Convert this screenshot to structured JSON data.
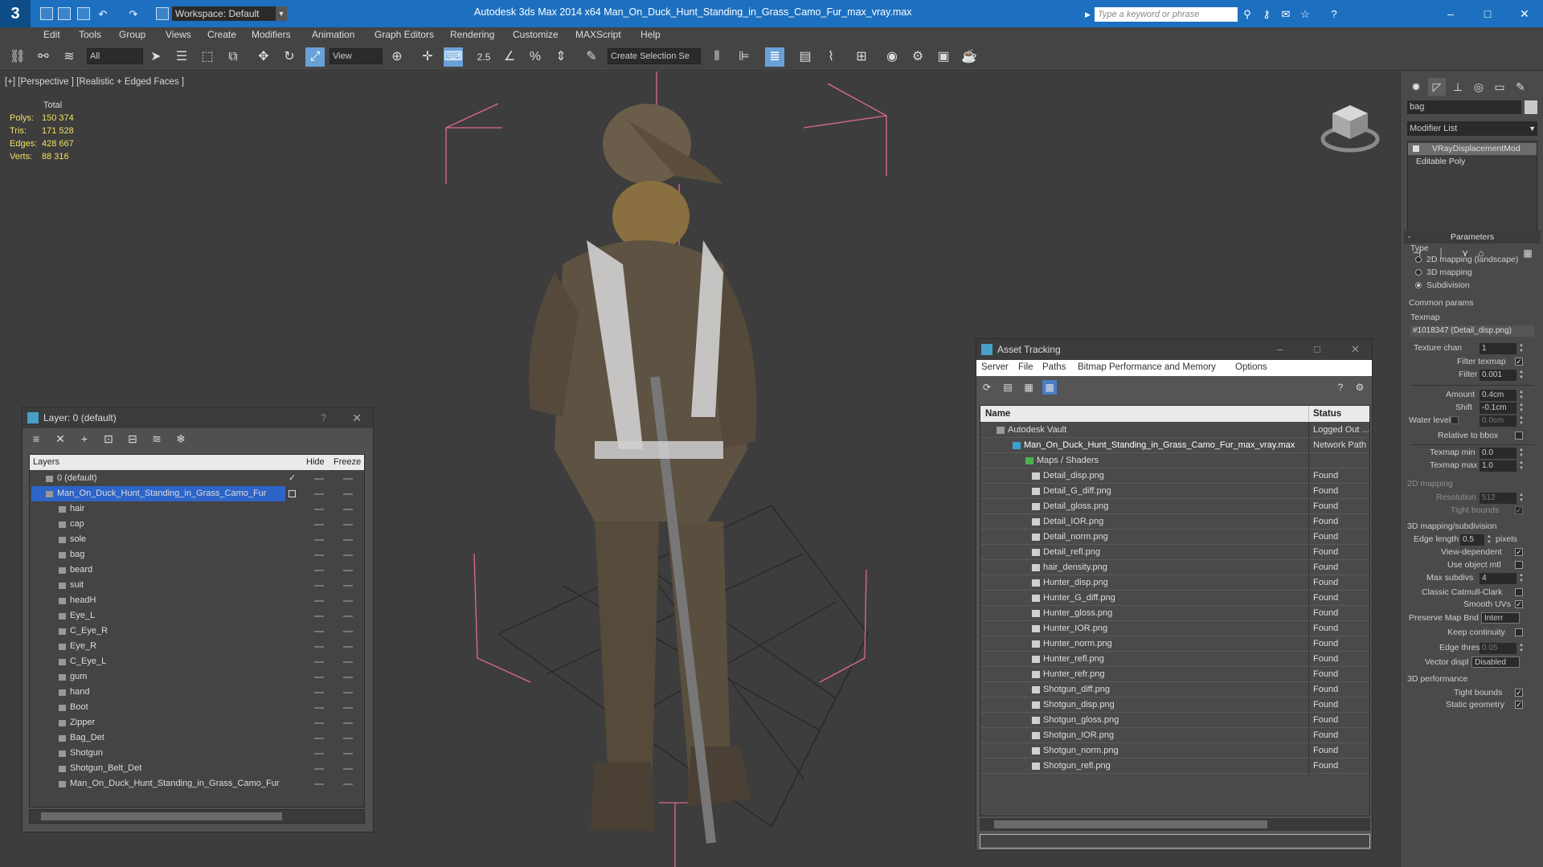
{
  "app": {
    "logo": "3",
    "title": "Autodesk 3ds Max  2014 x64      Man_On_Duck_Hunt_Standing_in_Grass_Camo_Fur_max_vray.max",
    "workspace": "Workspace: Default",
    "search_placeholder": "Type a keyword or phrase"
  },
  "menu": [
    "Edit",
    "Tools",
    "Group",
    "Views",
    "Create",
    "Modifiers",
    "Animation",
    "Graph Editors",
    "Rendering",
    "Customize",
    "MAXScript",
    "Help"
  ],
  "toolbar": {
    "selection_filter": "All",
    "ref_coord": "View",
    "named_selection": "Create Selection Se",
    "snap_label": "2.5"
  },
  "viewport": {
    "label": "[+] [Perspective ] [Realistic + Edged Faces ]",
    "stats": {
      "total_label": "Total",
      "rows": [
        {
          "label": "Polys:",
          "value": "150 374"
        },
        {
          "label": "Tris:",
          "value": "171 528"
        },
        {
          "label": "Edges:",
          "value": "428 667"
        },
        {
          "label": "Verts:",
          "value": "88 316"
        }
      ]
    }
  },
  "layer_window": {
    "title": "Layer: 0 (default)",
    "help": "?",
    "headers": {
      "layers": "Layers",
      "hide": "Hide",
      "freeze": "Freeze"
    },
    "rows": [
      {
        "name": "0 (default)",
        "level": 0
      },
      {
        "name": "Man_On_Duck_Hunt_Standing_in_Grass_Camo_Fur",
        "level": 0
      },
      {
        "name": "hair",
        "level": 1
      },
      {
        "name": "cap",
        "level": 1
      },
      {
        "name": "sole",
        "level": 1
      },
      {
        "name": "bag",
        "level": 1
      },
      {
        "name": "beard",
        "level": 1
      },
      {
        "name": "suit",
        "level": 1
      },
      {
        "name": "headH",
        "level": 1
      },
      {
        "name": "Eye_L",
        "level": 1
      },
      {
        "name": "C_Eye_R",
        "level": 1
      },
      {
        "name": "Eye_R",
        "level": 1
      },
      {
        "name": "C_Eye_L",
        "level": 1
      },
      {
        "name": "gum",
        "level": 1
      },
      {
        "name": "hand",
        "level": 1
      },
      {
        "name": "Boot",
        "level": 1
      },
      {
        "name": "Zipper",
        "level": 1
      },
      {
        "name": "Bag_Det",
        "level": 1
      },
      {
        "name": "Shotgun",
        "level": 1
      },
      {
        "name": "Shotgun_Belt_Det",
        "level": 1
      },
      {
        "name": "Man_On_Duck_Hunt_Standing_in_Grass_Camo_Fur",
        "level": 1
      }
    ]
  },
  "asset_window": {
    "title": "Asset Tracking",
    "menu": [
      "Server",
      "File",
      "Paths",
      "Bitmap Performance and Memory",
      "Options"
    ],
    "headers": {
      "name": "Name",
      "status": "Status"
    },
    "rows": [
      {
        "name": "Autodesk Vault",
        "status": "Logged Out ...",
        "level": 0,
        "kind": "vault"
      },
      {
        "name": "Man_On_Duck_Hunt_Standing_in_Grass_Camo_Fur_max_vray.max",
        "status": "Network Path",
        "level": 1,
        "kind": "max"
      },
      {
        "name": "Maps / Shaders",
        "status": "",
        "level": 2,
        "kind": "folder"
      },
      {
        "name": "Detail_disp.png",
        "status": "Found",
        "level": 3,
        "kind": "png"
      },
      {
        "name": "Detail_G_diff.png",
        "status": "Found",
        "level": 3,
        "kind": "png"
      },
      {
        "name": "Detail_gloss.png",
        "status": "Found",
        "level": 3,
        "kind": "png"
      },
      {
        "name": "Detail_IOR.png",
        "status": "Found",
        "level": 3,
        "kind": "png"
      },
      {
        "name": "Detail_norm.png",
        "status": "Found",
        "level": 3,
        "kind": "png"
      },
      {
        "name": "Detail_refl.png",
        "status": "Found",
        "level": 3,
        "kind": "png"
      },
      {
        "name": "hair_density.png",
        "status": "Found",
        "level": 3,
        "kind": "png"
      },
      {
        "name": "Hunter_disp.png",
        "status": "Found",
        "level": 3,
        "kind": "png"
      },
      {
        "name": "Hunter_G_diff.png",
        "status": "Found",
        "level": 3,
        "kind": "png"
      },
      {
        "name": "Hunter_gloss.png",
        "status": "Found",
        "level": 3,
        "kind": "png"
      },
      {
        "name": "Hunter_IOR.png",
        "status": "Found",
        "level": 3,
        "kind": "png"
      },
      {
        "name": "Hunter_norm.png",
        "status": "Found",
        "level": 3,
        "kind": "png"
      },
      {
        "name": "Hunter_refl.png",
        "status": "Found",
        "level": 3,
        "kind": "png"
      },
      {
        "name": "Hunter_refr.png",
        "status": "Found",
        "level": 3,
        "kind": "png"
      },
      {
        "name": "Shotgun_diff.png",
        "status": "Found",
        "level": 3,
        "kind": "png"
      },
      {
        "name": "Shotgun_disp.png",
        "status": "Found",
        "level": 3,
        "kind": "png"
      },
      {
        "name": "Shotgun_gloss.png",
        "status": "Found",
        "level": 3,
        "kind": "png"
      },
      {
        "name": "Shotgun_IOR.png",
        "status": "Found",
        "level": 3,
        "kind": "png"
      },
      {
        "name": "Shotgun_norm.png",
        "status": "Found",
        "level": 3,
        "kind": "png"
      },
      {
        "name": "Shotgun_refl.png",
        "status": "Found",
        "level": 3,
        "kind": "png"
      }
    ]
  },
  "command_panel": {
    "object_name": "bag",
    "modifier_list": "Modifier List",
    "stack": [
      "VRayDisplacementMod",
      "Editable Poly"
    ],
    "parameters_title": "Parameters",
    "type_label": "Type",
    "type_options": [
      "2D mapping (landscape)",
      "3D mapping",
      "Subdivision"
    ],
    "common_params": "Common params",
    "texmap_label": "Texmap",
    "texmap_value": "#1018347 (Detail_disp.png)",
    "texture_chan_label": "Texture chan",
    "texture_chan_value": "1",
    "filter_texmap": "Filter texmap",
    "filter_blur_label": "Filter blur",
    "filter_blur_value": "0.001",
    "amount_label": "Amount",
    "amount_value": "0.4cm",
    "shift_label": "Shift",
    "shift_value": "-0.1cm",
    "water_level_label": "Water level",
    "water_level_value": "0.0cm",
    "relative_bbox": "Relative to bbox",
    "texmap_min_label": "Texmap min",
    "texmap_min_value": "0.0",
    "texmap_max_label": "Texmap max",
    "texmap_max_value": "1.0",
    "mapping_2d": "2D mapping",
    "resolution_label": "Resolution",
    "resolution_value": "512",
    "tight_bounds": "Tight bounds",
    "mapping_3d": "3D mapping/subdivision",
    "edge_length_label": "Edge length",
    "edge_length_value": "0.5",
    "pixels": "pixels",
    "view_dependent": "View-dependent",
    "use_object_mtl": "Use object mtl",
    "max_subdivs_label": "Max subdivs",
    "max_subdivs_value": "4",
    "classic_catmull": "Classic Catmull-Clark",
    "smooth_uvs": "Smooth UVs",
    "preserve_map_bnd_label": "Preserve Map Bnd",
    "preserve_map_bnd_value": "Interr",
    "keep_continuity": "Keep continuity",
    "edge_thresh_label": "Edge thresh",
    "edge_thresh_value": "0.05",
    "vector_displ_label": "Vector displ",
    "vector_displ_value": "Disabled",
    "perf_3d": "3D performance",
    "tight_bounds_2": "Tight bounds",
    "static_geometry": "Static geometry"
  }
}
